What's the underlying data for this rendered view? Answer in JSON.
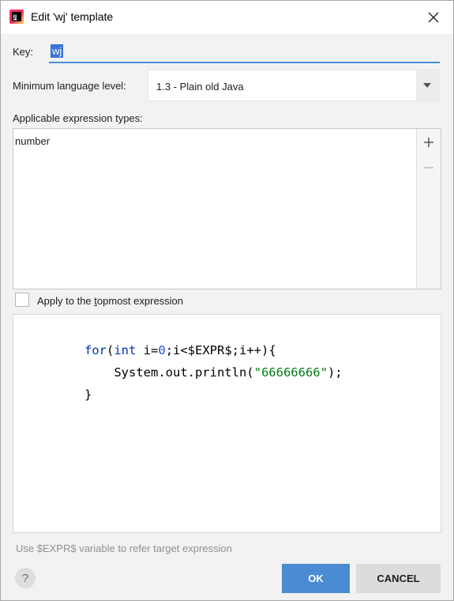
{
  "window": {
    "title": "Edit 'wj' template",
    "app_icon": "intellij-idea-icon",
    "close_icon": "close-icon"
  },
  "key": {
    "label": "Key:",
    "value": "wj"
  },
  "language_level": {
    "label": "Minimum language level:",
    "selected": "1.3 - Plain old Java"
  },
  "expression_types": {
    "label": "Applicable expression types:",
    "items": [
      "number"
    ],
    "add_icon": "plus-icon",
    "remove_icon": "minus-icon"
  },
  "topmost": {
    "label_pre": "Apply to the ",
    "label_mnemonic": "t",
    "label_post": "opmost expression",
    "checked": false
  },
  "code": {
    "line1": {
      "kw": "for",
      "p1": "(",
      "type": "int",
      "p2": " i=",
      "num": "0",
      "p3": ";i<$EXPR$;i++){"
    },
    "line2": {
      "p1": "    System.out.println(",
      "str": "\"66666666\"",
      "p2": ");"
    },
    "line3": "}"
  },
  "hint": "Use $EXPR$ variable to refer target expression",
  "buttons": {
    "help": "?",
    "ok": "OK",
    "cancel": "CANCEL"
  },
  "colors": {
    "accent": "#4a8bd3",
    "selection": "#3875d6",
    "keyword": "#0033b3",
    "number": "#1750eb",
    "string": "#067d17"
  }
}
